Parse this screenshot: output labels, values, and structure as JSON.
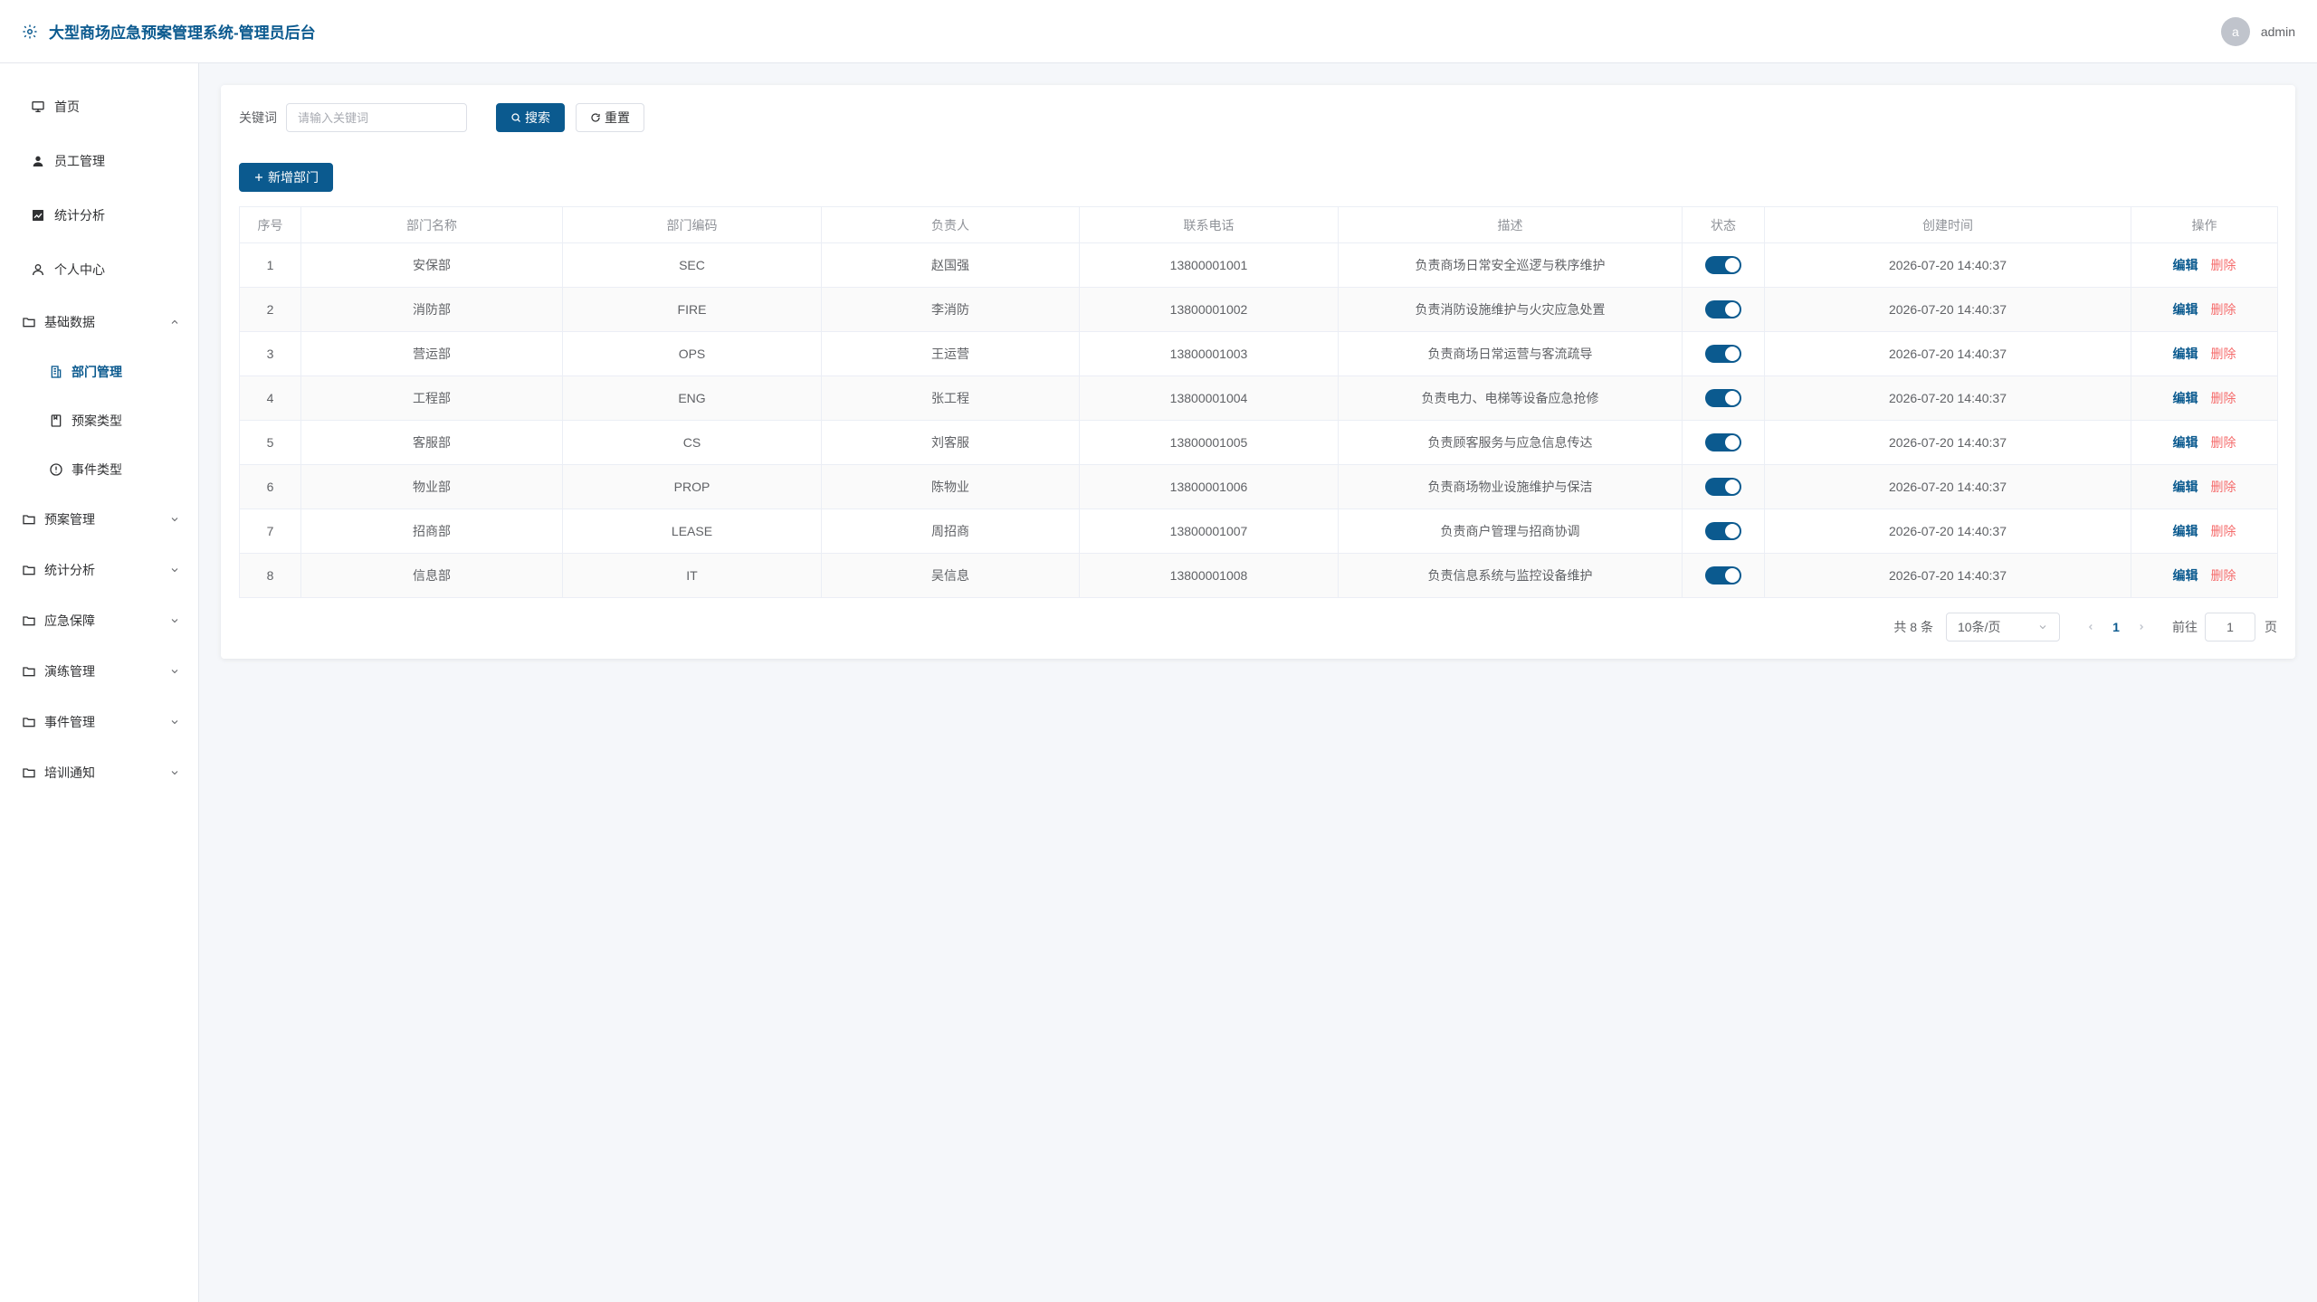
{
  "header": {
    "title": "大型商场应急预案管理系统-管理员后台",
    "avatar_letter": "a",
    "username": "admin"
  },
  "sidebar": {
    "items": [
      {
        "label": "首页",
        "icon": "monitor-icon"
      },
      {
        "label": "员工管理",
        "icon": "user-filled-icon"
      },
      {
        "label": "统计分析",
        "icon": "chart-icon"
      },
      {
        "label": "个人中心",
        "icon": "user-icon"
      }
    ],
    "groups": [
      {
        "label": "基础数据",
        "expanded": true
      },
      {
        "label": "预案管理",
        "expanded": false
      },
      {
        "label": "统计分析",
        "expanded": false
      },
      {
        "label": "应急保障",
        "expanded": false
      },
      {
        "label": "演练管理",
        "expanded": false
      },
      {
        "label": "事件管理",
        "expanded": false
      },
      {
        "label": "培训通知",
        "expanded": false
      }
    ],
    "sub_items": [
      {
        "label": "部门管理",
        "active": true
      },
      {
        "label": "预案类型",
        "active": false
      },
      {
        "label": "事件类型",
        "active": false
      }
    ]
  },
  "search": {
    "label": "关键词",
    "value": "",
    "placeholder": "请输入关键词",
    "search_label": "搜索",
    "reset_label": "重置"
  },
  "toolbar": {
    "add_label": "新增部门"
  },
  "table": {
    "columns": [
      "序号",
      "部门名称",
      "部门编码",
      "负责人",
      "联系电话",
      "描述",
      "状态",
      "创建时间",
      "操作"
    ],
    "rows": [
      {
        "index": "1",
        "name": "安保部",
        "code": "SEC",
        "leader": "赵国强",
        "phone": "13800001001",
        "desc": "负责商场日常安全巡逻与秩序维护",
        "enabled": true,
        "created": "2026-07-20 14:40:37"
      },
      {
        "index": "2",
        "name": "消防部",
        "code": "FIRE",
        "leader": "李消防",
        "phone": "13800001002",
        "desc": "负责消防设施维护与火灾应急处置",
        "enabled": true,
        "created": "2026-07-20 14:40:37"
      },
      {
        "index": "3",
        "name": "营运部",
        "code": "OPS",
        "leader": "王运营",
        "phone": "13800001003",
        "desc": "负责商场日常运营与客流疏导",
        "enabled": true,
        "created": "2026-07-20 14:40:37"
      },
      {
        "index": "4",
        "name": "工程部",
        "code": "ENG",
        "leader": "张工程",
        "phone": "13800001004",
        "desc": "负责电力、电梯等设备应急抢修",
        "enabled": true,
        "created": "2026-07-20 14:40:37"
      },
      {
        "index": "5",
        "name": "客服部",
        "code": "CS",
        "leader": "刘客服",
        "phone": "13800001005",
        "desc": "负责顾客服务与应急信息传达",
        "enabled": true,
        "created": "2026-07-20 14:40:37"
      },
      {
        "index": "6",
        "name": "物业部",
        "code": "PROP",
        "leader": "陈物业",
        "phone": "13800001006",
        "desc": "负责商场物业设施维护与保洁",
        "enabled": true,
        "created": "2026-07-20 14:40:37"
      },
      {
        "index": "7",
        "name": "招商部",
        "code": "LEASE",
        "leader": "周招商",
        "phone": "13800001007",
        "desc": "负责商户管理与招商协调",
        "enabled": true,
        "created": "2026-07-20 14:40:37"
      },
      {
        "index": "8",
        "name": "信息部",
        "code": "IT",
        "leader": "吴信息",
        "phone": "13800001008",
        "desc": "负责信息系统与监控设备维护",
        "enabled": true,
        "created": "2026-07-20 14:40:37"
      }
    ],
    "edit_label": "编辑",
    "delete_label": "删除"
  },
  "pagination": {
    "total_text": "共 8 条",
    "page_size": "10条/页",
    "current_page": "1",
    "goto_label": "前往",
    "goto_value": "1",
    "page_unit": "页"
  },
  "colors": {
    "primary": "#0b5a8f",
    "danger": "#f56c6c"
  }
}
